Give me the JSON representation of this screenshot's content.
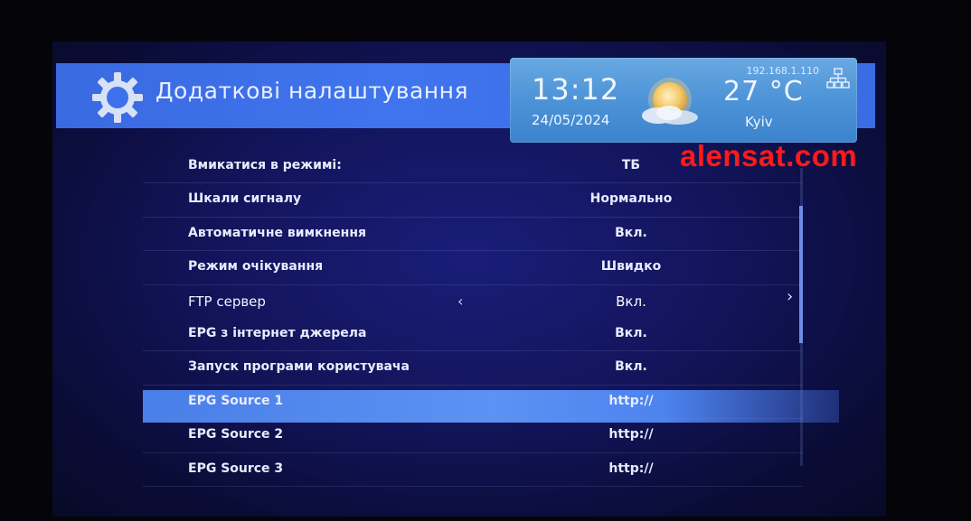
{
  "header": {
    "title": "Додаткові налаштування",
    "icon": "gear-icon"
  },
  "status": {
    "ip": "192.168.1.110",
    "time": "13:12",
    "date": "24/05/2024",
    "temperature": "27 °C",
    "city": "Kyiv",
    "weather_icon": "sun-cloud-icon",
    "network_icon": "network-icon"
  },
  "watermark": "alensat.com",
  "menu": {
    "items": [
      {
        "label": "Вмикатися в режимі:",
        "value": "ТБ"
      },
      {
        "label": "Шкали сигналу",
        "value": "Нормально"
      },
      {
        "label": "Автоматичне вимкнення",
        "value": "Вкл."
      },
      {
        "label": "Режим очікування",
        "value": "Швидко"
      },
      {
        "label": "FTP сервер",
        "value": "Вкл."
      },
      {
        "label": "EPG з інтернет джерела",
        "value": "Вкл."
      },
      {
        "label": "Запуск програми користувача",
        "value": "Вкл."
      },
      {
        "label": "EPG Source 1",
        "value": "http://"
      },
      {
        "label": "EPG Source 2",
        "value": "http://"
      },
      {
        "label": "EPG Source 3",
        "value": "http://"
      }
    ],
    "selected_index": 4,
    "left_arrow": "‹",
    "right_arrow": "›"
  },
  "colors": {
    "accent": "#3f74ee",
    "selected": "#5b92f3",
    "background": "#12145a",
    "watermark": "#ff1a1a"
  }
}
